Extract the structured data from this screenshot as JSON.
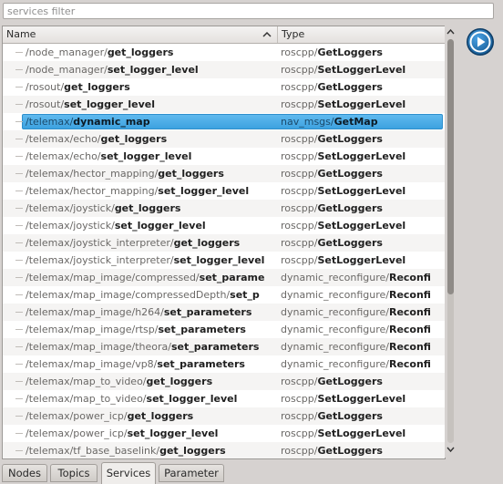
{
  "filter": {
    "placeholder": "services filter",
    "value": ""
  },
  "table": {
    "columns": {
      "name": "Name",
      "type": "Type"
    },
    "sort": "ascending",
    "rows": [
      {
        "prefix": "/node_manager/",
        "service": "get_loggers",
        "pkg": "roscpp/",
        "srv": "GetLoggers"
      },
      {
        "prefix": "/node_manager/",
        "service": "set_logger_level",
        "pkg": "roscpp/",
        "srv": "SetLoggerLevel"
      },
      {
        "prefix": "/rosout/",
        "service": "get_loggers",
        "pkg": "roscpp/",
        "srv": "GetLoggers"
      },
      {
        "prefix": "/rosout/",
        "service": "set_logger_level",
        "pkg": "roscpp/",
        "srv": "SetLoggerLevel"
      },
      {
        "prefix": "/telemax/",
        "service": "dynamic_map",
        "pkg": "nav_msgs/",
        "srv": "GetMap",
        "selected": true
      },
      {
        "prefix": "/telemax/echo/",
        "service": "get_loggers",
        "pkg": "roscpp/",
        "srv": "GetLoggers"
      },
      {
        "prefix": "/telemax/echo/",
        "service": "set_logger_level",
        "pkg": "roscpp/",
        "srv": "SetLoggerLevel"
      },
      {
        "prefix": "/telemax/hector_mapping/",
        "service": "get_loggers",
        "pkg": "roscpp/",
        "srv": "GetLoggers"
      },
      {
        "prefix": "/telemax/hector_mapping/",
        "service": "set_logger_level",
        "pkg": "roscpp/",
        "srv": "SetLoggerLevel"
      },
      {
        "prefix": "/telemax/joystick/",
        "service": "get_loggers",
        "pkg": "roscpp/",
        "srv": "GetLoggers"
      },
      {
        "prefix": "/telemax/joystick/",
        "service": "set_logger_level",
        "pkg": "roscpp/",
        "srv": "SetLoggerLevel"
      },
      {
        "prefix": "/telemax/joystick_interpreter/",
        "service": "get_loggers",
        "pkg": "roscpp/",
        "srv": "GetLoggers"
      },
      {
        "prefix": "/telemax/joystick_interpreter/",
        "service": "set_logger_level",
        "pkg": "roscpp/",
        "srv": "SetLoggerLevel"
      },
      {
        "prefix": "/telemax/map_image/compressed/",
        "service": "set_parame",
        "pkg": "dynamic_reconfigure/",
        "srv": "Reconfi"
      },
      {
        "prefix": "/telemax/map_image/compressedDepth/",
        "service": "set_p",
        "pkg": "dynamic_reconfigure/",
        "srv": "Reconfi"
      },
      {
        "prefix": "/telemax/map_image/h264/",
        "service": "set_parameters",
        "pkg": "dynamic_reconfigure/",
        "srv": "Reconfi"
      },
      {
        "prefix": "/telemax/map_image/rtsp/",
        "service": "set_parameters",
        "pkg": "dynamic_reconfigure/",
        "srv": "Reconfi"
      },
      {
        "prefix": "/telemax/map_image/theora/",
        "service": "set_parameters",
        "pkg": "dynamic_reconfigure/",
        "srv": "Reconfi"
      },
      {
        "prefix": "/telemax/map_image/vp8/",
        "service": "set_parameters",
        "pkg": "dynamic_reconfigure/",
        "srv": "Reconfi"
      },
      {
        "prefix": "/telemax/map_to_video/",
        "service": "get_loggers",
        "pkg": "roscpp/",
        "srv": "GetLoggers"
      },
      {
        "prefix": "/telemax/map_to_video/",
        "service": "set_logger_level",
        "pkg": "roscpp/",
        "srv": "SetLoggerLevel"
      },
      {
        "prefix": "/telemax/power_icp/",
        "service": "get_loggers",
        "pkg": "roscpp/",
        "srv": "GetLoggers"
      },
      {
        "prefix": "/telemax/power_icp/",
        "service": "set_logger_level",
        "pkg": "roscpp/",
        "srv": "SetLoggerLevel"
      },
      {
        "prefix": "/telemax/tf_base_baselink/",
        "service": "get_loggers",
        "pkg": "roscpp/",
        "srv": "GetLoggers"
      }
    ]
  },
  "scrollbar": {
    "position": 0.0
  },
  "actions": {
    "call_icon": "play-icon"
  },
  "tabs": [
    {
      "label": "Nodes",
      "active": false
    },
    {
      "label": "Topics",
      "active": false
    },
    {
      "label": "Services",
      "active": true
    },
    {
      "label": "Parameter",
      "active": false
    }
  ],
  "colors": {
    "selection": "#3da2e0",
    "play_button": "#1e6fae"
  }
}
